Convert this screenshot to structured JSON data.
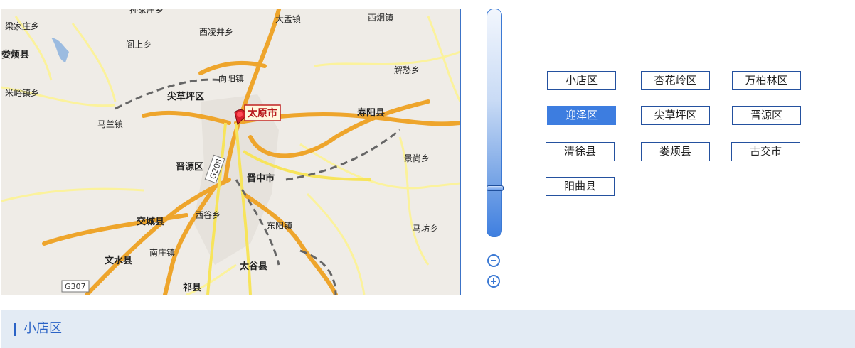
{
  "map": {
    "city_marker": "太原市",
    "pin_icon": "map-pin-icon",
    "road_label": "G208",
    "road_label_2": "G307",
    "places": {
      "p1": "孙家庄乡",
      "p2": "大盂镇",
      "p3": "西烟镇",
      "p4": "梁家庄乡",
      "p5": "西凌井乡",
      "p6": "娄烦县",
      "p7": "阎上乡",
      "p8": "解愁乡",
      "p9": "向阳镇",
      "p10": "米峪镇乡",
      "p11": "尖草坪区",
      "p12": "寿阳县",
      "p13": "马兰镇",
      "p14": "景尚乡",
      "p15": "晋源区",
      "p16": "晋中市",
      "p17": "交城县",
      "p18": "西谷乡",
      "p19": "东阳镇",
      "p20": "马坊乡",
      "p21": "文水县",
      "p22": "南庄镇",
      "p23": "太谷县",
      "p24": "祁县"
    }
  },
  "zoom": {
    "level_fraction": 0.79,
    "zoom_out_icon": "zoom-out-icon",
    "zoom_in_icon": "zoom-in-icon"
  },
  "districts": [
    {
      "label": "小店区",
      "active": false
    },
    {
      "label": "杏花岭区",
      "active": false
    },
    {
      "label": "万柏林区",
      "active": false
    },
    {
      "label": "迎泽区",
      "active": true
    },
    {
      "label": "尖草坪区",
      "active": false
    },
    {
      "label": "晋源区",
      "active": false
    },
    {
      "label": "清徐县",
      "active": false
    },
    {
      "label": "娄烦县",
      "active": false
    },
    {
      "label": "古交市",
      "active": false
    },
    {
      "label": "阳曲县",
      "active": false
    }
  ],
  "selected": {
    "label": "小店区",
    "accent_color": "#2b63c6"
  },
  "colors": {
    "active_district_bg": "#3d7de0",
    "district_border": "#24519f",
    "bottom_bar_bg": "#e3ebf4"
  }
}
